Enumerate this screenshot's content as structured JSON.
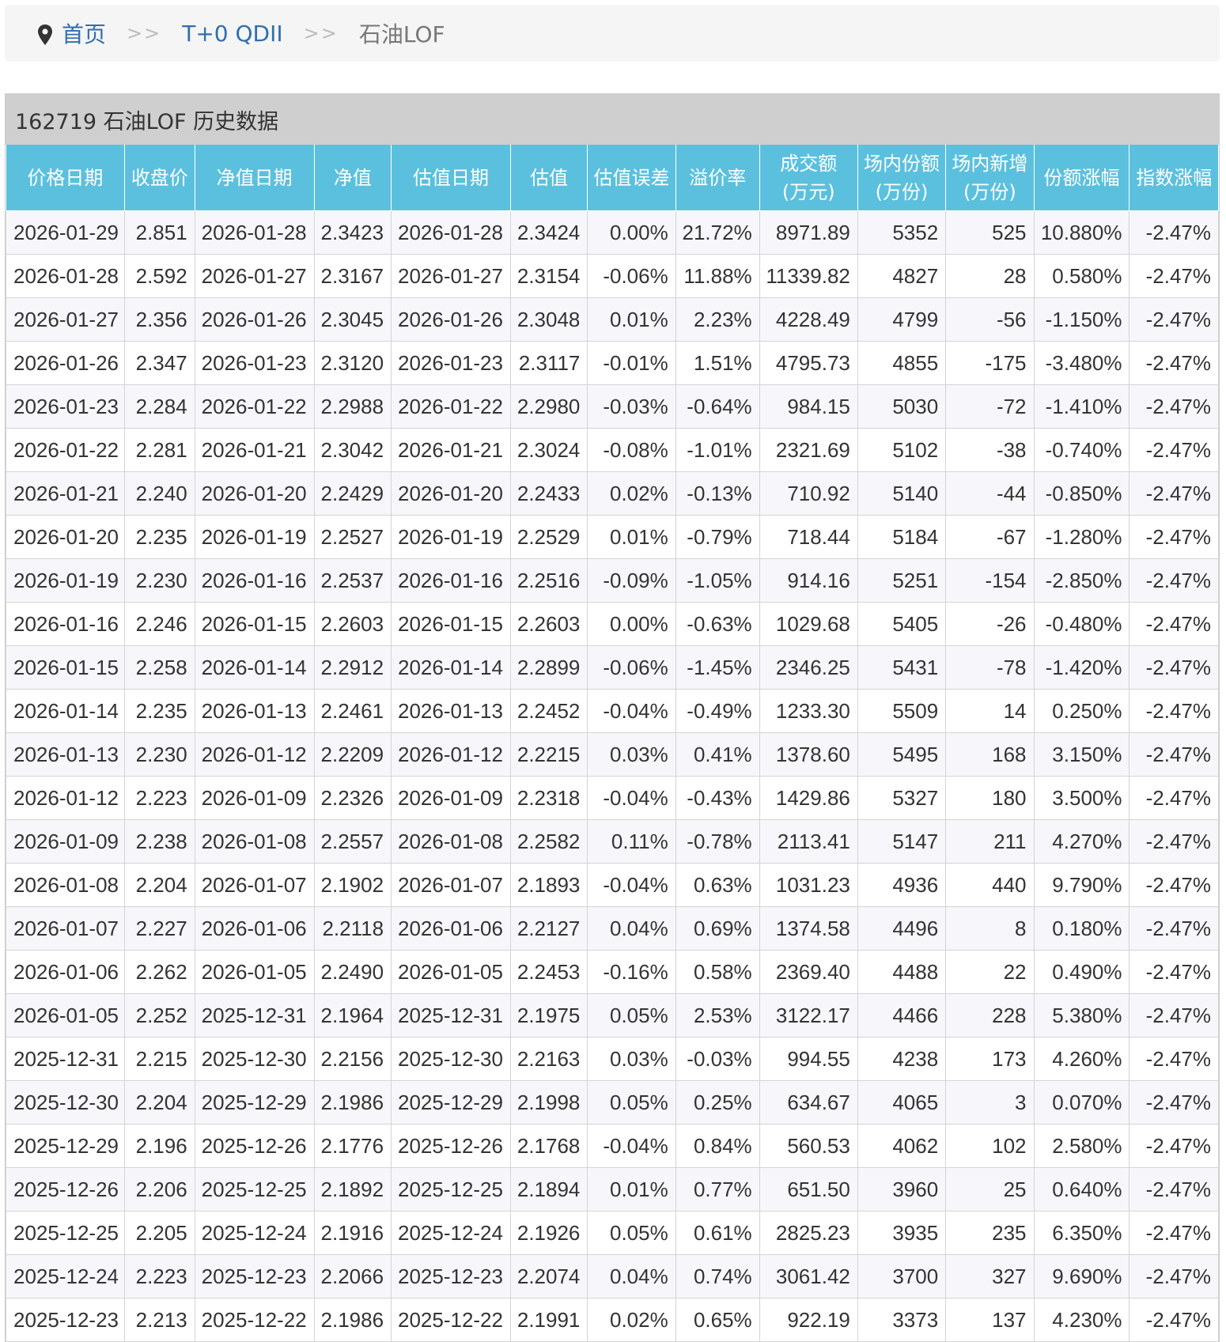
{
  "breadcrumb": {
    "home": "首页",
    "separator": ">>",
    "category": "T+0 QDII",
    "current": "石油LOF"
  },
  "panel": {
    "title": "162719 石油LOF 历史数据"
  },
  "table": {
    "columns": [
      "价格日期",
      "收盘价",
      "净值日期",
      "净值",
      "估值日期",
      "估值",
      "估值误差",
      "溢价率",
      "成交额\n(万元)",
      "场内份额\n(万份)",
      "场内新增\n(万份)",
      "份额涨幅",
      "指数涨幅"
    ],
    "rows": [
      [
        "2026-01-29",
        "2.851",
        "2026-01-28",
        "2.3423",
        "2026-01-28",
        "2.3424",
        "0.00%",
        "21.72%",
        "8971.89",
        "5352",
        "525",
        "10.880%",
        "-2.47%"
      ],
      [
        "2026-01-28",
        "2.592",
        "2026-01-27",
        "2.3167",
        "2026-01-27",
        "2.3154",
        "-0.06%",
        "11.88%",
        "11339.82",
        "4827",
        "28",
        "0.580%",
        "-2.47%"
      ],
      [
        "2026-01-27",
        "2.356",
        "2026-01-26",
        "2.3045",
        "2026-01-26",
        "2.3048",
        "0.01%",
        "2.23%",
        "4228.49",
        "4799",
        "-56",
        "-1.150%",
        "-2.47%"
      ],
      [
        "2026-01-26",
        "2.347",
        "2026-01-23",
        "2.3120",
        "2026-01-23",
        "2.3117",
        "-0.01%",
        "1.51%",
        "4795.73",
        "4855",
        "-175",
        "-3.480%",
        "-2.47%"
      ],
      [
        "2026-01-23",
        "2.284",
        "2026-01-22",
        "2.2988",
        "2026-01-22",
        "2.2980",
        "-0.03%",
        "-0.64%",
        "984.15",
        "5030",
        "-72",
        "-1.410%",
        "-2.47%"
      ],
      [
        "2026-01-22",
        "2.281",
        "2026-01-21",
        "2.3042",
        "2026-01-21",
        "2.3024",
        "-0.08%",
        "-1.01%",
        "2321.69",
        "5102",
        "-38",
        "-0.740%",
        "-2.47%"
      ],
      [
        "2026-01-21",
        "2.240",
        "2026-01-20",
        "2.2429",
        "2026-01-20",
        "2.2433",
        "0.02%",
        "-0.13%",
        "710.92",
        "5140",
        "-44",
        "-0.850%",
        "-2.47%"
      ],
      [
        "2026-01-20",
        "2.235",
        "2026-01-19",
        "2.2527",
        "2026-01-19",
        "2.2529",
        "0.01%",
        "-0.79%",
        "718.44",
        "5184",
        "-67",
        "-1.280%",
        "-2.47%"
      ],
      [
        "2026-01-19",
        "2.230",
        "2026-01-16",
        "2.2537",
        "2026-01-16",
        "2.2516",
        "-0.09%",
        "-1.05%",
        "914.16",
        "5251",
        "-154",
        "-2.850%",
        "-2.47%"
      ],
      [
        "2026-01-16",
        "2.246",
        "2026-01-15",
        "2.2603",
        "2026-01-15",
        "2.2603",
        "0.00%",
        "-0.63%",
        "1029.68",
        "5405",
        "-26",
        "-0.480%",
        "-2.47%"
      ],
      [
        "2026-01-15",
        "2.258",
        "2026-01-14",
        "2.2912",
        "2026-01-14",
        "2.2899",
        "-0.06%",
        "-1.45%",
        "2346.25",
        "5431",
        "-78",
        "-1.420%",
        "-2.47%"
      ],
      [
        "2026-01-14",
        "2.235",
        "2026-01-13",
        "2.2461",
        "2026-01-13",
        "2.2452",
        "-0.04%",
        "-0.49%",
        "1233.30",
        "5509",
        "14",
        "0.250%",
        "-2.47%"
      ],
      [
        "2026-01-13",
        "2.230",
        "2026-01-12",
        "2.2209",
        "2026-01-12",
        "2.2215",
        "0.03%",
        "0.41%",
        "1378.60",
        "5495",
        "168",
        "3.150%",
        "-2.47%"
      ],
      [
        "2026-01-12",
        "2.223",
        "2026-01-09",
        "2.2326",
        "2026-01-09",
        "2.2318",
        "-0.04%",
        "-0.43%",
        "1429.86",
        "5327",
        "180",
        "3.500%",
        "-2.47%"
      ],
      [
        "2026-01-09",
        "2.238",
        "2026-01-08",
        "2.2557",
        "2026-01-08",
        "2.2582",
        "0.11%",
        "-0.78%",
        "2113.41",
        "5147",
        "211",
        "4.270%",
        "-2.47%"
      ],
      [
        "2026-01-08",
        "2.204",
        "2026-01-07",
        "2.1902",
        "2026-01-07",
        "2.1893",
        "-0.04%",
        "0.63%",
        "1031.23",
        "4936",
        "440",
        "9.790%",
        "-2.47%"
      ],
      [
        "2026-01-07",
        "2.227",
        "2026-01-06",
        "2.2118",
        "2026-01-06",
        "2.2127",
        "0.04%",
        "0.69%",
        "1374.58",
        "4496",
        "8",
        "0.180%",
        "-2.47%"
      ],
      [
        "2026-01-06",
        "2.262",
        "2026-01-05",
        "2.2490",
        "2026-01-05",
        "2.2453",
        "-0.16%",
        "0.58%",
        "2369.40",
        "4488",
        "22",
        "0.490%",
        "-2.47%"
      ],
      [
        "2026-01-05",
        "2.252",
        "2025-12-31",
        "2.1964",
        "2025-12-31",
        "2.1975",
        "0.05%",
        "2.53%",
        "3122.17",
        "4466",
        "228",
        "5.380%",
        "-2.47%"
      ],
      [
        "2025-12-31",
        "2.215",
        "2025-12-30",
        "2.2156",
        "2025-12-30",
        "2.2163",
        "0.03%",
        "-0.03%",
        "994.55",
        "4238",
        "173",
        "4.260%",
        "-2.47%"
      ],
      [
        "2025-12-30",
        "2.204",
        "2025-12-29",
        "2.1986",
        "2025-12-29",
        "2.1998",
        "0.05%",
        "0.25%",
        "634.67",
        "4065",
        "3",
        "0.070%",
        "-2.47%"
      ],
      [
        "2025-12-29",
        "2.196",
        "2025-12-26",
        "2.1776",
        "2025-12-26",
        "2.1768",
        "-0.04%",
        "0.84%",
        "560.53",
        "4062",
        "102",
        "2.580%",
        "-2.47%"
      ],
      [
        "2025-12-26",
        "2.206",
        "2025-12-25",
        "2.1892",
        "2025-12-25",
        "2.1894",
        "0.01%",
        "0.77%",
        "651.50",
        "3960",
        "25",
        "0.640%",
        "-2.47%"
      ],
      [
        "2025-12-25",
        "2.205",
        "2025-12-24",
        "2.1916",
        "2025-12-24",
        "2.1926",
        "0.05%",
        "0.61%",
        "2825.23",
        "3935",
        "235",
        "6.350%",
        "-2.47%"
      ],
      [
        "2025-12-24",
        "2.223",
        "2025-12-23",
        "2.2066",
        "2025-12-23",
        "2.2074",
        "0.04%",
        "0.74%",
        "3061.42",
        "3700",
        "327",
        "9.690%",
        "-2.47%"
      ],
      [
        "2025-12-23",
        "2.213",
        "2025-12-22",
        "2.1986",
        "2025-12-22",
        "2.1991",
        "0.02%",
        "0.65%",
        "922.19",
        "3373",
        "137",
        "4.230%",
        "-2.47%"
      ]
    ]
  }
}
